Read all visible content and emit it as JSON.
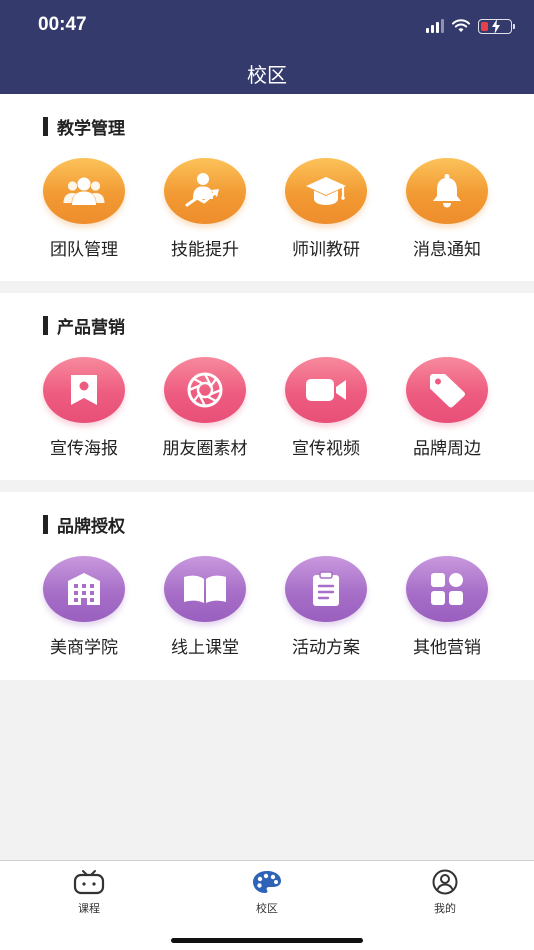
{
  "status_bar": {
    "time": "00:47"
  },
  "nav": {
    "title": "校区"
  },
  "sections": [
    {
      "title": "教学管理",
      "color": "#f29a33",
      "items": [
        {
          "label": "团队管理",
          "icon": "team-icon"
        },
        {
          "label": "技能提升",
          "icon": "skill-growth-icon"
        },
        {
          "label": "师训教研",
          "icon": "graduation-cap-icon"
        },
        {
          "label": "消息通知",
          "icon": "bell-icon"
        }
      ]
    },
    {
      "title": "产品营销",
      "color": "#ee5c80",
      "items": [
        {
          "label": "宣传海报",
          "icon": "poster-icon"
        },
        {
          "label": "朋友圈素材",
          "icon": "camera-aperture-icon"
        },
        {
          "label": "宣传视频",
          "icon": "video-camera-icon"
        },
        {
          "label": "品牌周边",
          "icon": "tag-icon"
        }
      ]
    },
    {
      "title": "品牌授权",
      "color": "#a76fc8",
      "items": [
        {
          "label": "美商学院",
          "icon": "building-icon"
        },
        {
          "label": "线上课堂",
          "icon": "open-book-icon"
        },
        {
          "label": "活动方案",
          "icon": "clipboard-icon"
        },
        {
          "label": "其他营销",
          "icon": "apps-grid-icon"
        }
      ]
    }
  ],
  "tabbar": {
    "tabs": [
      {
        "label": "课程",
        "icon": "course-tv-icon",
        "active": false
      },
      {
        "label": "校区",
        "icon": "palette-icon",
        "active": true
      },
      {
        "label": "我的",
        "icon": "user-icon",
        "active": false
      }
    ]
  }
}
